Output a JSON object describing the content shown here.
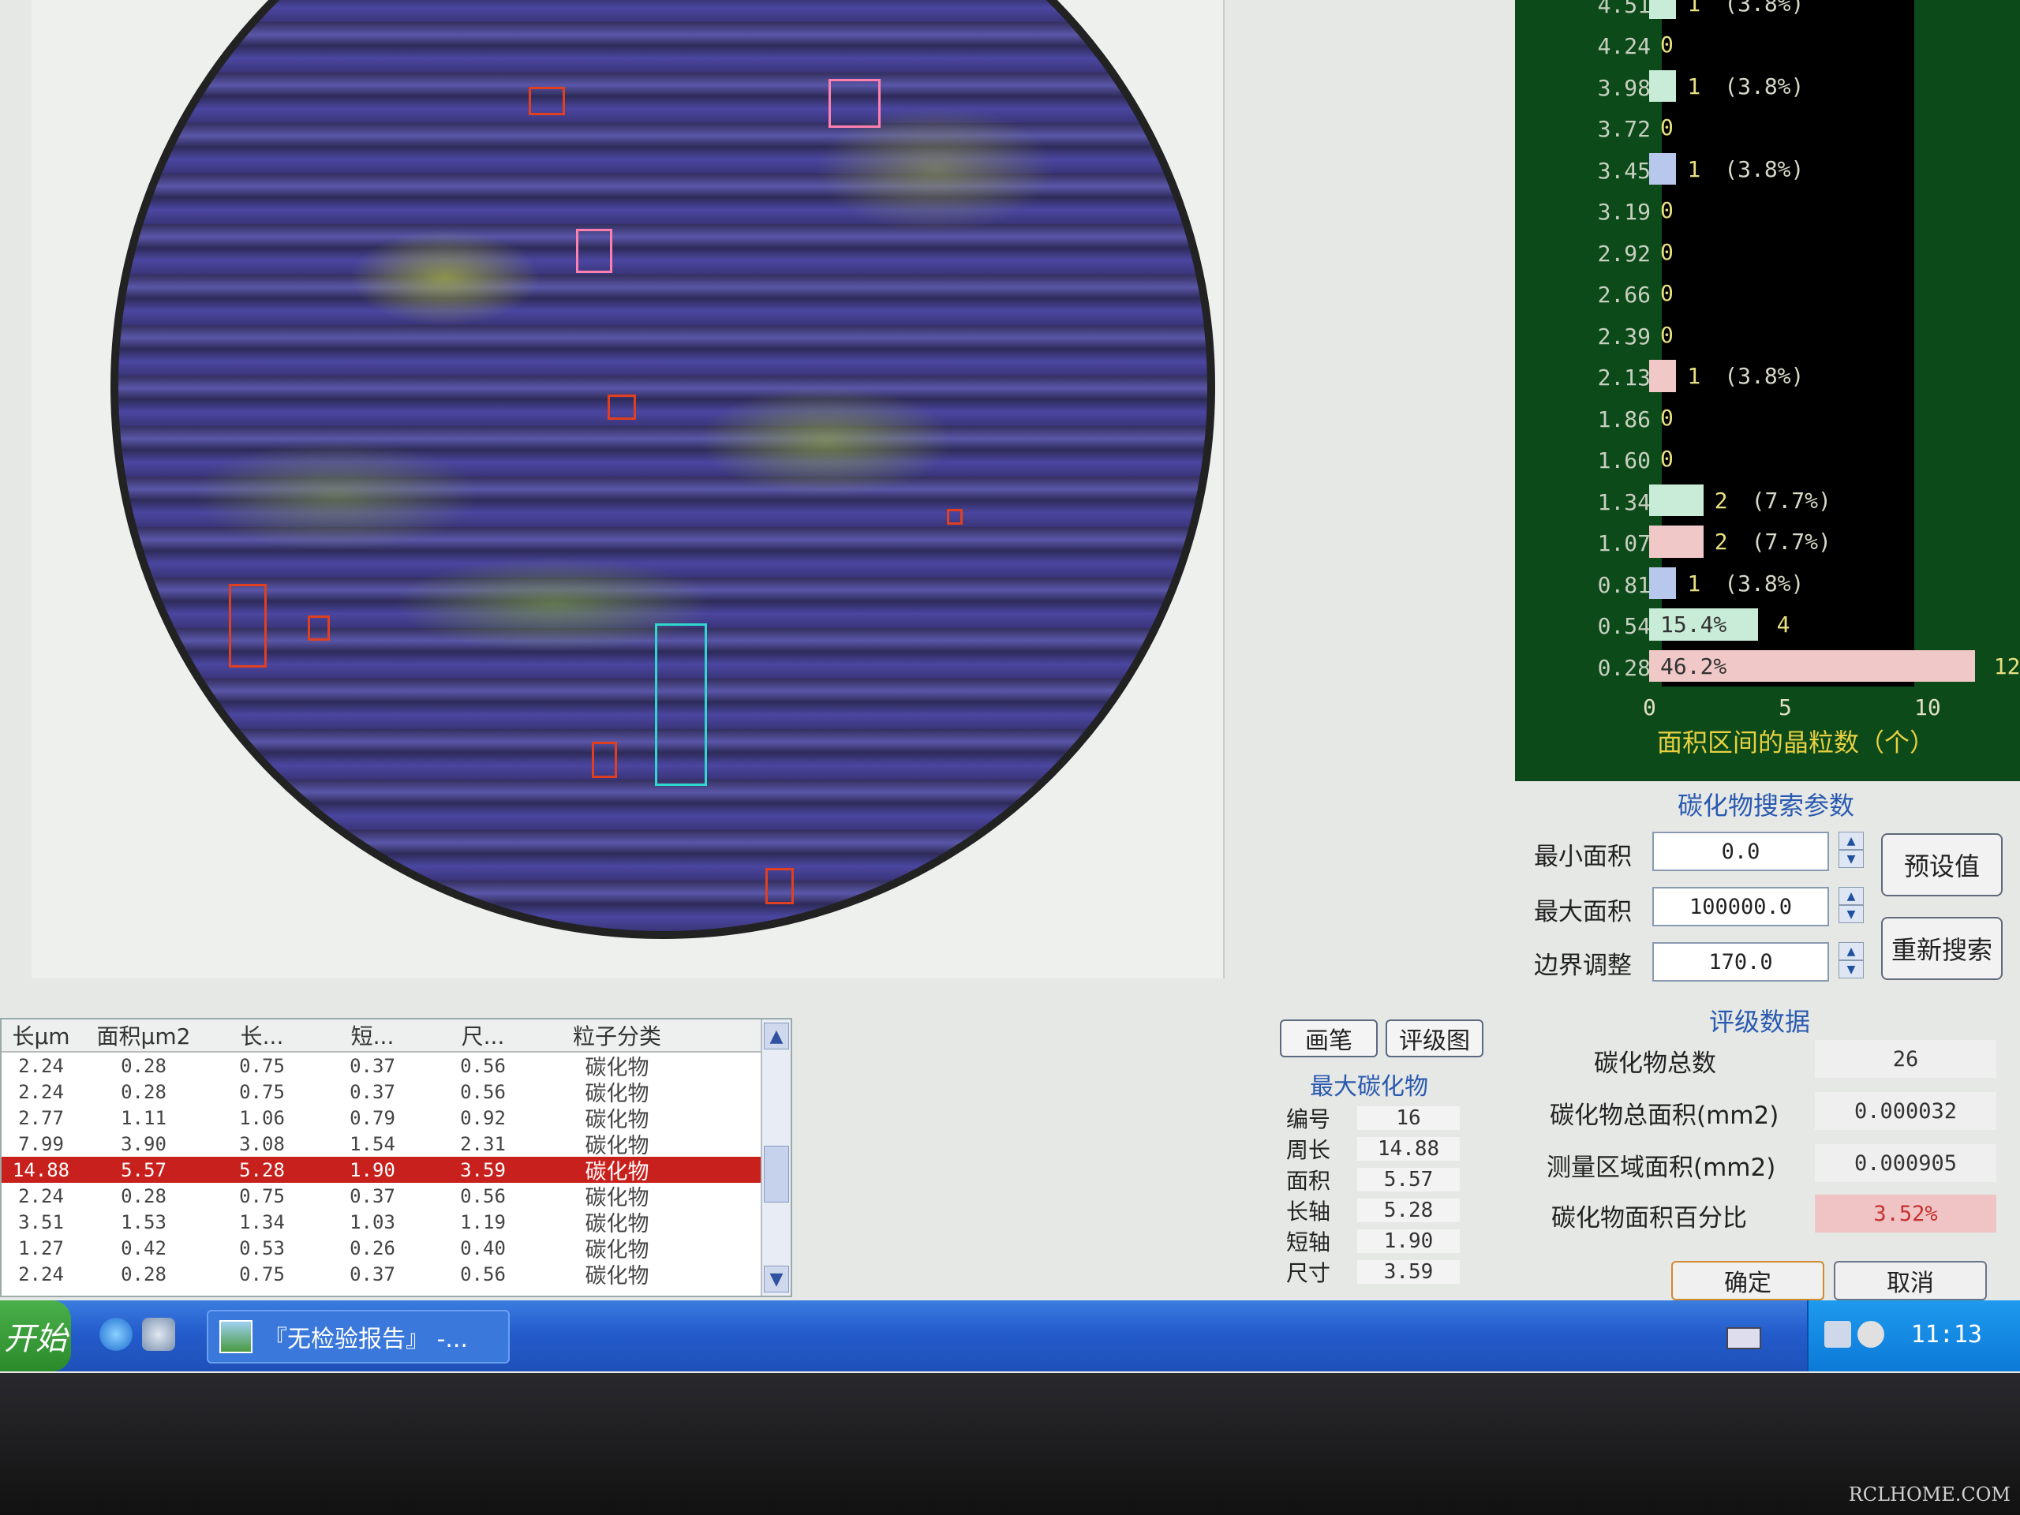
{
  "table": {
    "headers": [
      "长μm",
      "面积μm2",
      "长...",
      "短...",
      "尺...",
      "粒子分类"
    ],
    "rows": [
      [
        "2.24",
        "0.28",
        "0.75",
        "0.37",
        "0.56",
        "碳化物"
      ],
      [
        "2.24",
        "0.28",
        "0.75",
        "0.37",
        "0.56",
        "碳化物"
      ],
      [
        "2.77",
        "1.11",
        "1.06",
        "0.79",
        "0.92",
        "碳化物"
      ],
      [
        "7.99",
        "3.90",
        "3.08",
        "1.54",
        "2.31",
        "碳化物"
      ],
      [
        "14.88",
        "5.57",
        "5.28",
        "1.90",
        "3.59",
        "碳化物"
      ],
      [
        "2.24",
        "0.28",
        "0.75",
        "0.37",
        "0.56",
        "碳化物"
      ],
      [
        "3.51",
        "1.53",
        "1.34",
        "1.03",
        "1.19",
        "碳化物"
      ],
      [
        "1.27",
        "0.42",
        "0.53",
        "0.26",
        "0.40",
        "碳化物"
      ],
      [
        "2.24",
        "0.28",
        "0.75",
        "0.37",
        "0.56",
        "碳化物"
      ]
    ],
    "selected_row": 4
  },
  "tools": {
    "pen": "画笔",
    "grade_chart": "评级图"
  },
  "max_carbide": {
    "title": "最大碳化物",
    "items": [
      {
        "label": "编号",
        "value": "16"
      },
      {
        "label": "周长",
        "value": "14.88"
      },
      {
        "label": "面积",
        "value": "5.57"
      },
      {
        "label": "长轴",
        "value": "5.28"
      },
      {
        "label": "短轴",
        "value": "1.90"
      },
      {
        "label": "尺寸",
        "value": "3.59"
      }
    ]
  },
  "chart_data": {
    "type": "bar",
    "orientation": "horizontal",
    "xlabel": "面积区间的晶粒数（个）",
    "xlim": [
      0,
      12
    ],
    "xticks": [
      "0",
      "5",
      "10"
    ],
    "categories": [
      "0.28",
      "0.54",
      "0.81",
      "1.07",
      "1.34",
      "1.60",
      "1.86",
      "2.13",
      "2.39",
      "2.66",
      "2.92",
      "3.19",
      "3.45",
      "3.72",
      "3.98",
      "4.24",
      "4.51"
    ],
    "values": [
      12,
      4,
      1,
      2,
      2,
      0,
      0,
      1,
      0,
      0,
      0,
      0,
      1,
      0,
      1,
      0,
      1
    ],
    "value_labels": [
      "12",
      "4",
      "1",
      "2",
      "2",
      "0",
      "0",
      "1",
      "0",
      "0",
      "0",
      "0",
      "1",
      "0",
      "1",
      "0",
      "1"
    ],
    "percent_labels": [
      "46.2%",
      "15.4%",
      "(3.8%)",
      "(7.7%)",
      "(7.7%)",
      "",
      "",
      "(3.8%)",
      "",
      "",
      "",
      "",
      "(3.8%)",
      "",
      "(3.8%)",
      "",
      "(3.8%)"
    ],
    "colors": [
      "#f0c8c8",
      "#c8ecd8",
      "#b8c8ec",
      "#f0c8c8",
      "#c8ecd8",
      "#f0c8c8",
      "#c8ecd8",
      "#f0c8c8",
      "#c8ecd8",
      "#b8c8ec",
      "#f0c8c8",
      "#c8ecd8",
      "#b8c8ec",
      "#f0c8c8",
      "#c8ecd8",
      "#f0c8c8",
      "#c8ecd8"
    ]
  },
  "search_params": {
    "title": "碳化物搜索参数",
    "min_area_label": "最小面积",
    "min_area": "0.0",
    "max_area_label": "最大面积",
    "max_area": "100000.0",
    "border_label": "边界调整",
    "border": "170.0",
    "preset_button": "预设值",
    "research_button": "重新搜索"
  },
  "evaluation": {
    "title": "评级数据",
    "total_count_label": "碳化物总数",
    "total_count": "26",
    "total_area_label": "碳化物总面积(mm2)",
    "total_area": "0.000032",
    "measure_area_label": "测量区域面积(mm2)",
    "measure_area": "0.000905",
    "percent_label": "碳化物面积百分比",
    "percent": "3.52%"
  },
  "dialog": {
    "ok": "确定",
    "cancel": "取消"
  },
  "taskbar": {
    "start": "开始",
    "task": "『无检验报告』 -...",
    "time": "11:13"
  },
  "watermark": "RCLHOME.COM",
  "colors": {
    "selected_row": "#c8201c",
    "chart_bg": "#0c4a1a",
    "group_title": "#2a5ab0",
    "highlight": "#f0c4c4"
  }
}
